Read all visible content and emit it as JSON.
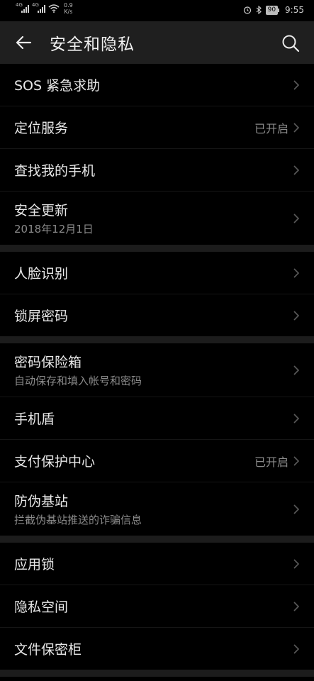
{
  "status_bar": {
    "net1": "4G",
    "net2": "4G",
    "speed_value": "0.9",
    "speed_unit": "K/s",
    "battery": "90",
    "time": "9:55"
  },
  "app_bar": {
    "title": "安全和隐私"
  },
  "groups": [
    [
      {
        "title": "SOS 紧急求助"
      },
      {
        "title": "定位服务",
        "status": "已开启"
      },
      {
        "title": "查找我的手机"
      },
      {
        "title": "安全更新",
        "subtitle": "2018年12月1日"
      }
    ],
    [
      {
        "title": "人脸识别"
      },
      {
        "title": "锁屏密码"
      }
    ],
    [
      {
        "title": "密码保险箱",
        "subtitle": "自动保存和填入帐号和密码"
      },
      {
        "title": "手机盾"
      },
      {
        "title": "支付保护中心",
        "status": "已开启"
      },
      {
        "title": "防伪基站",
        "subtitle": "拦截伪基站推送的诈骗信息"
      }
    ],
    [
      {
        "title": "应用锁"
      },
      {
        "title": "隐私空间"
      },
      {
        "title": "文件保密柜"
      }
    ]
  ]
}
